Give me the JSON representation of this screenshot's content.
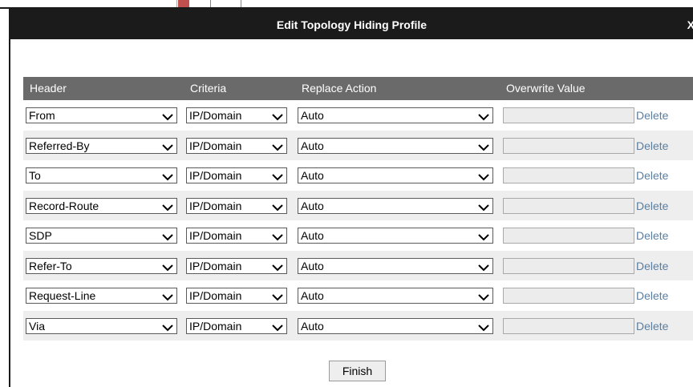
{
  "dialog": {
    "title": "Edit Topology Hiding Profile",
    "close_label": "X"
  },
  "table": {
    "columns": {
      "header": "Header",
      "criteria": "Criteria",
      "replace_action": "Replace Action",
      "overwrite_value": "Overwrite Value"
    },
    "rows": [
      {
        "header": "From",
        "criteria": "IP/Domain",
        "replace_action": "Auto",
        "overwrite_value": "",
        "delete_label": "Delete"
      },
      {
        "header": "Referred-By",
        "criteria": "IP/Domain",
        "replace_action": "Auto",
        "overwrite_value": "",
        "delete_label": "Delete"
      },
      {
        "header": "To",
        "criteria": "IP/Domain",
        "replace_action": "Auto",
        "overwrite_value": "",
        "delete_label": "Delete"
      },
      {
        "header": "Record-Route",
        "criteria": "IP/Domain",
        "replace_action": "Auto",
        "overwrite_value": "",
        "delete_label": "Delete"
      },
      {
        "header": "SDP",
        "criteria": "IP/Domain",
        "replace_action": "Auto",
        "overwrite_value": "",
        "delete_label": "Delete"
      },
      {
        "header": "Refer-To",
        "criteria": "IP/Domain",
        "replace_action": "Auto",
        "overwrite_value": "",
        "delete_label": "Delete"
      },
      {
        "header": "Request-Line",
        "criteria": "IP/Domain",
        "replace_action": "Auto",
        "overwrite_value": "",
        "delete_label": "Delete"
      },
      {
        "header": "Via",
        "criteria": "IP/Domain",
        "replace_action": "Auto",
        "overwrite_value": "",
        "delete_label": "Delete"
      }
    ]
  },
  "footer": {
    "finish_label": "Finish"
  },
  "colors": {
    "titlebar": "#1b1b1b",
    "table_header": "#6a6a6a",
    "row_alt": "#eeeeee",
    "delete_link": "#5a7ea0"
  },
  "icons": {
    "dropdown": "chevron-down-icon"
  }
}
